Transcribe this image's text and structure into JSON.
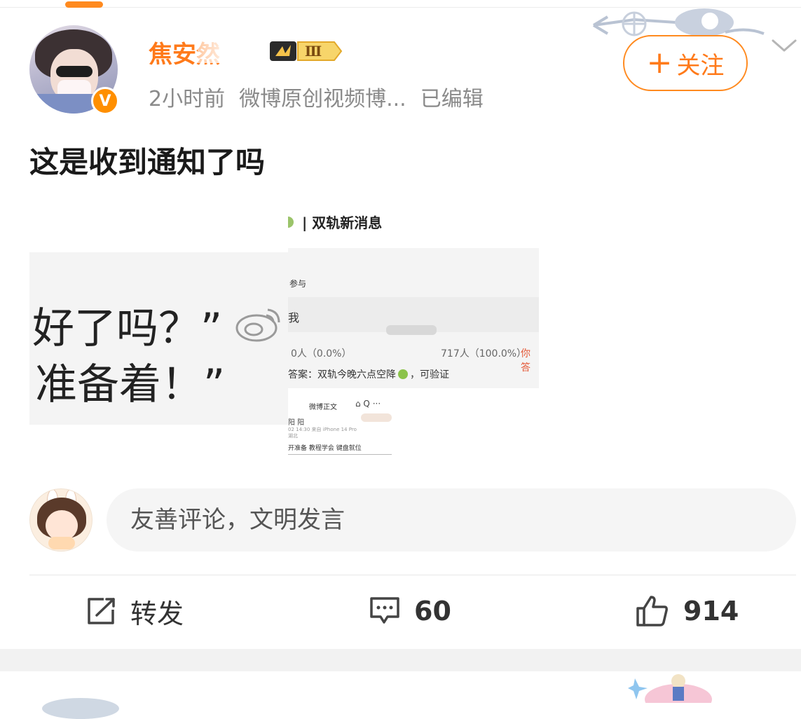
{
  "post": {
    "author": {
      "name": "焦安然",
      "level_badge": "Ⅲ",
      "verified_glyph": "V"
    },
    "meta": {
      "time": "2小时前",
      "source": "微博原创视频博...",
      "edited": "已编辑"
    },
    "follow_button": {
      "plus": "+",
      "label": "关注"
    },
    "text": "这是收到通知了吗",
    "images": {
      "left": {
        "line1": "好了吗？”",
        "line2": "准备着！”"
      },
      "right": {
        "title": "双轨新消息",
        "row1": "参与",
        "row2": "我",
        "stats_left": "0人（0.0%）",
        "stats_right": "717人（100.0%）",
        "stats_you": "你答",
        "answer_prefix": "答案：双轨今晚六点空降",
        "answer_suffix": "，可验证",
        "weibo_title": "微博正文",
        "weibo_icons": "⌂ Q ···",
        "weibo_name": "阳 阳",
        "weibo_small": "02 14:30  来自 iPhone 14 Pro",
        "weibo_small2": "湖北",
        "weibo_text": "开准备 教程学会 键盘就位"
      }
    }
  },
  "comment_box": {
    "placeholder": "友善评论，文明发言"
  },
  "actions": {
    "repost": {
      "label": "转发"
    },
    "comment": {
      "count": "60"
    },
    "like": {
      "count": "914"
    }
  },
  "colors": {
    "accent": "#ff7a1a",
    "verified": "#ff8f00",
    "meta_gray": "#8a8a8a",
    "input_bg": "#f5f5f5"
  },
  "icons": {
    "repost": "repost-icon",
    "comment": "comment-icon",
    "like": "thumbs-up-icon",
    "more": "chevron-down-icon",
    "verified": "verified-icon"
  }
}
